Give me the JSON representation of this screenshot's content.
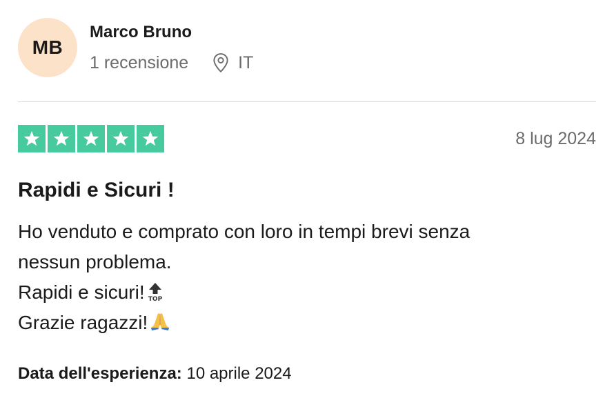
{
  "reviewer": {
    "initials": "MB",
    "name": "Marco Bruno",
    "reviews_count": "1 recensione",
    "country": "IT",
    "avatar_color": "#fbe2c9"
  },
  "review": {
    "rating": 5,
    "max_rating": 5,
    "star_color": "#00b67a",
    "date": "8 lug 2024",
    "title": "Rapidi e Sicuri !",
    "body_lines": [
      "Ho venduto e comprato con loro in tempi brevi senza",
      "nessun problema.",
      "Rapidi e sicuri!",
      "Grazie ragazzi!"
    ],
    "emojis": [
      "top-arrow-emoji",
      "folded-hands-emoji"
    ],
    "experience_label": "Data dell'esperienza:",
    "experience_date": "10 aprile 2024"
  },
  "icons": {
    "location": "map-pin-icon",
    "star": "star-icon"
  }
}
